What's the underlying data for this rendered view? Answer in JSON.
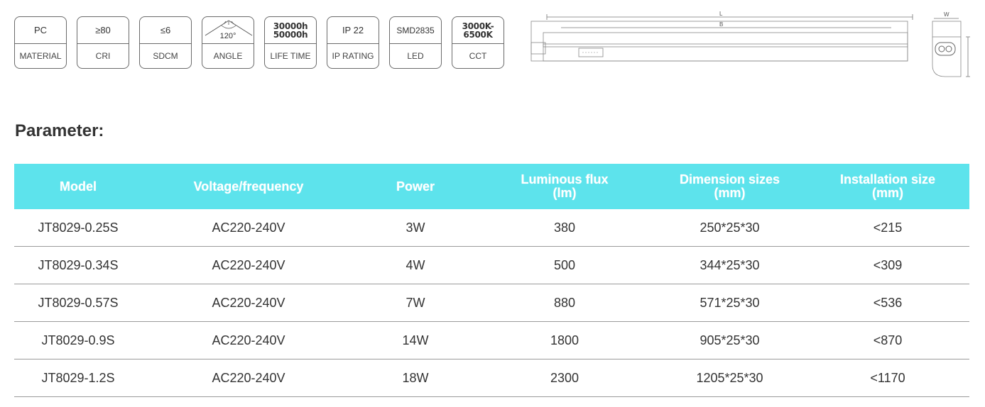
{
  "badges": [
    {
      "top": "PC",
      "bottom": "MATERIAL"
    },
    {
      "top": "≥80",
      "bottom": "CRI"
    },
    {
      "top": "≤6",
      "bottom": "SDCM"
    },
    {
      "top": "120°",
      "bottom": "ANGLE"
    },
    {
      "top": "30000h\n50000h",
      "bottom": "LIFE TIME"
    },
    {
      "top": "IP 22",
      "bottom": "IP RATING"
    },
    {
      "top": "SMD2835",
      "bottom": "LED"
    },
    {
      "top": "3000K-\n6500K",
      "bottom": "CCT"
    }
  ],
  "drawing": {
    "length_label": "L",
    "inner_label": "B",
    "width_label": "W"
  },
  "section_title": "Parameter:",
  "table": {
    "headers": [
      "Model",
      "Voltage/frequency",
      "Power",
      "Luminous flux\n(lm)",
      "Dimension sizes\n(mm)",
      "Installation size\n(mm)"
    ],
    "rows": [
      [
        "JT8029-0.25S",
        "AC220-240V",
        "3W",
        "380",
        "250*25*30",
        "<215"
      ],
      [
        "JT8029-0.34S",
        "AC220-240V",
        "4W",
        "500",
        "344*25*30",
        "<309"
      ],
      [
        "JT8029-0.57S",
        "AC220-240V",
        "7W",
        "880",
        "571*25*30",
        "<536"
      ],
      [
        "JT8029-0.9S",
        "AC220-240V",
        "14W",
        "1800",
        "905*25*30",
        "<870"
      ],
      [
        "JT8029-1.2S",
        "AC220-240V",
        "18W",
        "2300",
        "1205*25*30",
        "<1170"
      ]
    ]
  }
}
